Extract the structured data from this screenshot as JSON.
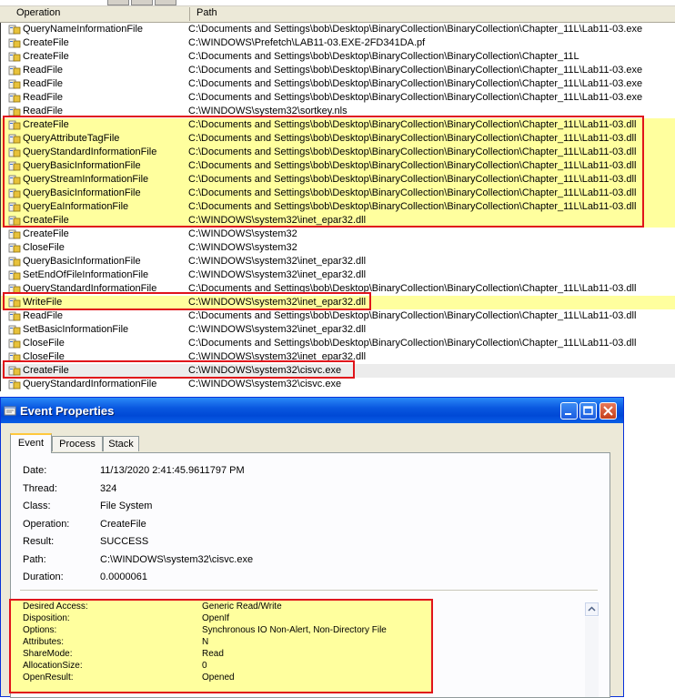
{
  "columns": {
    "operation": "Operation",
    "path": "Path"
  },
  "rows": [
    {
      "op": "QueryNameInformationFile",
      "path": "C:\\Documents and Settings\\bob\\Desktop\\BinaryCollection\\BinaryCollection\\Chapter_11L\\Lab11-03.exe"
    },
    {
      "op": "CreateFile",
      "path": "C:\\WINDOWS\\Prefetch\\LAB11-03.EXE-2FD341DA.pf"
    },
    {
      "op": "CreateFile",
      "path": "C:\\Documents and Settings\\bob\\Desktop\\BinaryCollection\\BinaryCollection\\Chapter_11L"
    },
    {
      "op": "ReadFile",
      "path": "C:\\Documents and Settings\\bob\\Desktop\\BinaryCollection\\BinaryCollection\\Chapter_11L\\Lab11-03.exe"
    },
    {
      "op": "ReadFile",
      "path": "C:\\Documents and Settings\\bob\\Desktop\\BinaryCollection\\BinaryCollection\\Chapter_11L\\Lab11-03.exe"
    },
    {
      "op": "ReadFile",
      "path": "C:\\Documents and Settings\\bob\\Desktop\\BinaryCollection\\BinaryCollection\\Chapter_11L\\Lab11-03.exe"
    },
    {
      "op": "ReadFile",
      "path": "C:\\WINDOWS\\system32\\sortkey.nls"
    },
    {
      "op": "CreateFile",
      "path": "C:\\Documents and Settings\\bob\\Desktop\\BinaryCollection\\BinaryCollection\\Chapter_11L\\Lab11-03.dll",
      "hl": true
    },
    {
      "op": "QueryAttributeTagFile",
      "path": "C:\\Documents and Settings\\bob\\Desktop\\BinaryCollection\\BinaryCollection\\Chapter_11L\\Lab11-03.dll",
      "hl": true
    },
    {
      "op": "QueryStandardInformationFile",
      "path": "C:\\Documents and Settings\\bob\\Desktop\\BinaryCollection\\BinaryCollection\\Chapter_11L\\Lab11-03.dll",
      "hl": true
    },
    {
      "op": "QueryBasicInformationFile",
      "path": "C:\\Documents and Settings\\bob\\Desktop\\BinaryCollection\\BinaryCollection\\Chapter_11L\\Lab11-03.dll",
      "hl": true
    },
    {
      "op": "QueryStreamInformationFile",
      "path": "C:\\Documents and Settings\\bob\\Desktop\\BinaryCollection\\BinaryCollection\\Chapter_11L\\Lab11-03.dll",
      "hl": true
    },
    {
      "op": "QueryBasicInformationFile",
      "path": "C:\\Documents and Settings\\bob\\Desktop\\BinaryCollection\\BinaryCollection\\Chapter_11L\\Lab11-03.dll",
      "hl": true
    },
    {
      "op": "QueryEaInformationFile",
      "path": "C:\\Documents and Settings\\bob\\Desktop\\BinaryCollection\\BinaryCollection\\Chapter_11L\\Lab11-03.dll",
      "hl": true
    },
    {
      "op": "CreateFile",
      "path": "C:\\WINDOWS\\system32\\inet_epar32.dll",
      "hl": true
    },
    {
      "op": "CreateFile",
      "path": "C:\\WINDOWS\\system32"
    },
    {
      "op": "CloseFile",
      "path": "C:\\WINDOWS\\system32"
    },
    {
      "op": "QueryBasicInformationFile",
      "path": "C:\\WINDOWS\\system32\\inet_epar32.dll"
    },
    {
      "op": "SetEndOfFileInformationFile",
      "path": "C:\\WINDOWS\\system32\\inet_epar32.dll"
    },
    {
      "op": "QueryStandardInformationFile",
      "path": "C:\\Documents and Settings\\bob\\Desktop\\BinaryCollection\\BinaryCollection\\Chapter_11L\\Lab11-03.dll"
    },
    {
      "op": "WriteFile",
      "path": "C:\\WINDOWS\\system32\\inet_epar32.dll",
      "hl": true
    },
    {
      "op": "ReadFile",
      "path": "C:\\Documents and Settings\\bob\\Desktop\\BinaryCollection\\BinaryCollection\\Chapter_11L\\Lab11-03.dll"
    },
    {
      "op": "SetBasicInformationFile",
      "path": "C:\\WINDOWS\\system32\\inet_epar32.dll"
    },
    {
      "op": "CloseFile",
      "path": "C:\\Documents and Settings\\bob\\Desktop\\BinaryCollection\\BinaryCollection\\Chapter_11L\\Lab11-03.dll"
    },
    {
      "op": "CloseFile",
      "path": "C:\\WINDOWS\\system32\\inet_epar32.dll"
    },
    {
      "op": "CreateFile",
      "path": "C:\\WINDOWS\\system32\\cisvc.exe",
      "sel": true
    },
    {
      "op": "QueryStandardInformationFile",
      "path": "C:\\WINDOWS\\system32\\cisvc.exe"
    }
  ],
  "dialog": {
    "title": "Event Properties",
    "tabs": [
      "Event",
      "Process",
      "Stack"
    ],
    "active_tab": "Event",
    "fields": [
      {
        "label": "Date:",
        "value": "11/13/2020 2:41:45.9611797 PM"
      },
      {
        "label": "Thread:",
        "value": "324"
      },
      {
        "label": "Class:",
        "value": "File System"
      },
      {
        "label": "Operation:",
        "value": "CreateFile"
      },
      {
        "label": "Result:",
        "value": "SUCCESS"
      },
      {
        "label": "Path:",
        "value": "C:\\WINDOWS\\system32\\cisvc.exe"
      },
      {
        "label": "Duration:",
        "value": "0.0000061"
      }
    ],
    "details": [
      {
        "label": "Desired Access:",
        "value": "Generic Read/Write"
      },
      {
        "label": "Disposition:",
        "value": "OpenIf"
      },
      {
        "label": "Options:",
        "value": "Synchronous IO Non-Alert, Non-Directory File"
      },
      {
        "label": "Attributes:",
        "value": "N"
      },
      {
        "label": "ShareMode:",
        "value": "Read"
      },
      {
        "label": "AllocationSize:",
        "value": "0"
      },
      {
        "label": "OpenResult:",
        "value": "Opened"
      }
    ]
  },
  "colors": {
    "highlight": "#ffff9e",
    "annotation_red": "#e0141b",
    "title_blue": "#0a58e0"
  }
}
